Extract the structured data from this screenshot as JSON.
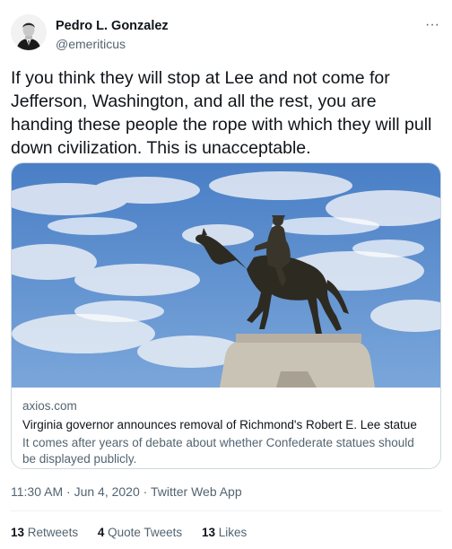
{
  "author": {
    "display_name": "Pedro L. Gonzalez",
    "handle": "@emeriticus",
    "avatar_icon": "profile-silhouette-icon"
  },
  "more_icon": "ellipsis-icon",
  "more_label": "···",
  "tweet_text": "If you think they will stop at Lee and not come for Jefferson, Washington, and all the rest, you are handing these people the rope with which they will pull down civilization. This is unacceptable.",
  "card": {
    "image_icon": "equestrian-statue-photo",
    "domain": "axios.com",
    "title": "Virginia governor announces removal of Richmond's Robert E. Lee statue",
    "description": "It comes after years of debate about whether Confederate statues should be displayed publicly."
  },
  "meta": {
    "time": "11:30 AM",
    "sep1": " · ",
    "date": "Jun 4, 2020",
    "sep2": " · ",
    "app": "Twitter Web App"
  },
  "stats": {
    "retweets_count": "13",
    "retweets_label": "Retweets",
    "quotes_count": "4",
    "quotes_label": "Quote Tweets",
    "likes_count": "13",
    "likes_label": "Likes"
  },
  "colors": {
    "text": "#0f1419",
    "secondary": "#536471",
    "border": "#cfd9de",
    "sky": "#5b8fd0"
  }
}
